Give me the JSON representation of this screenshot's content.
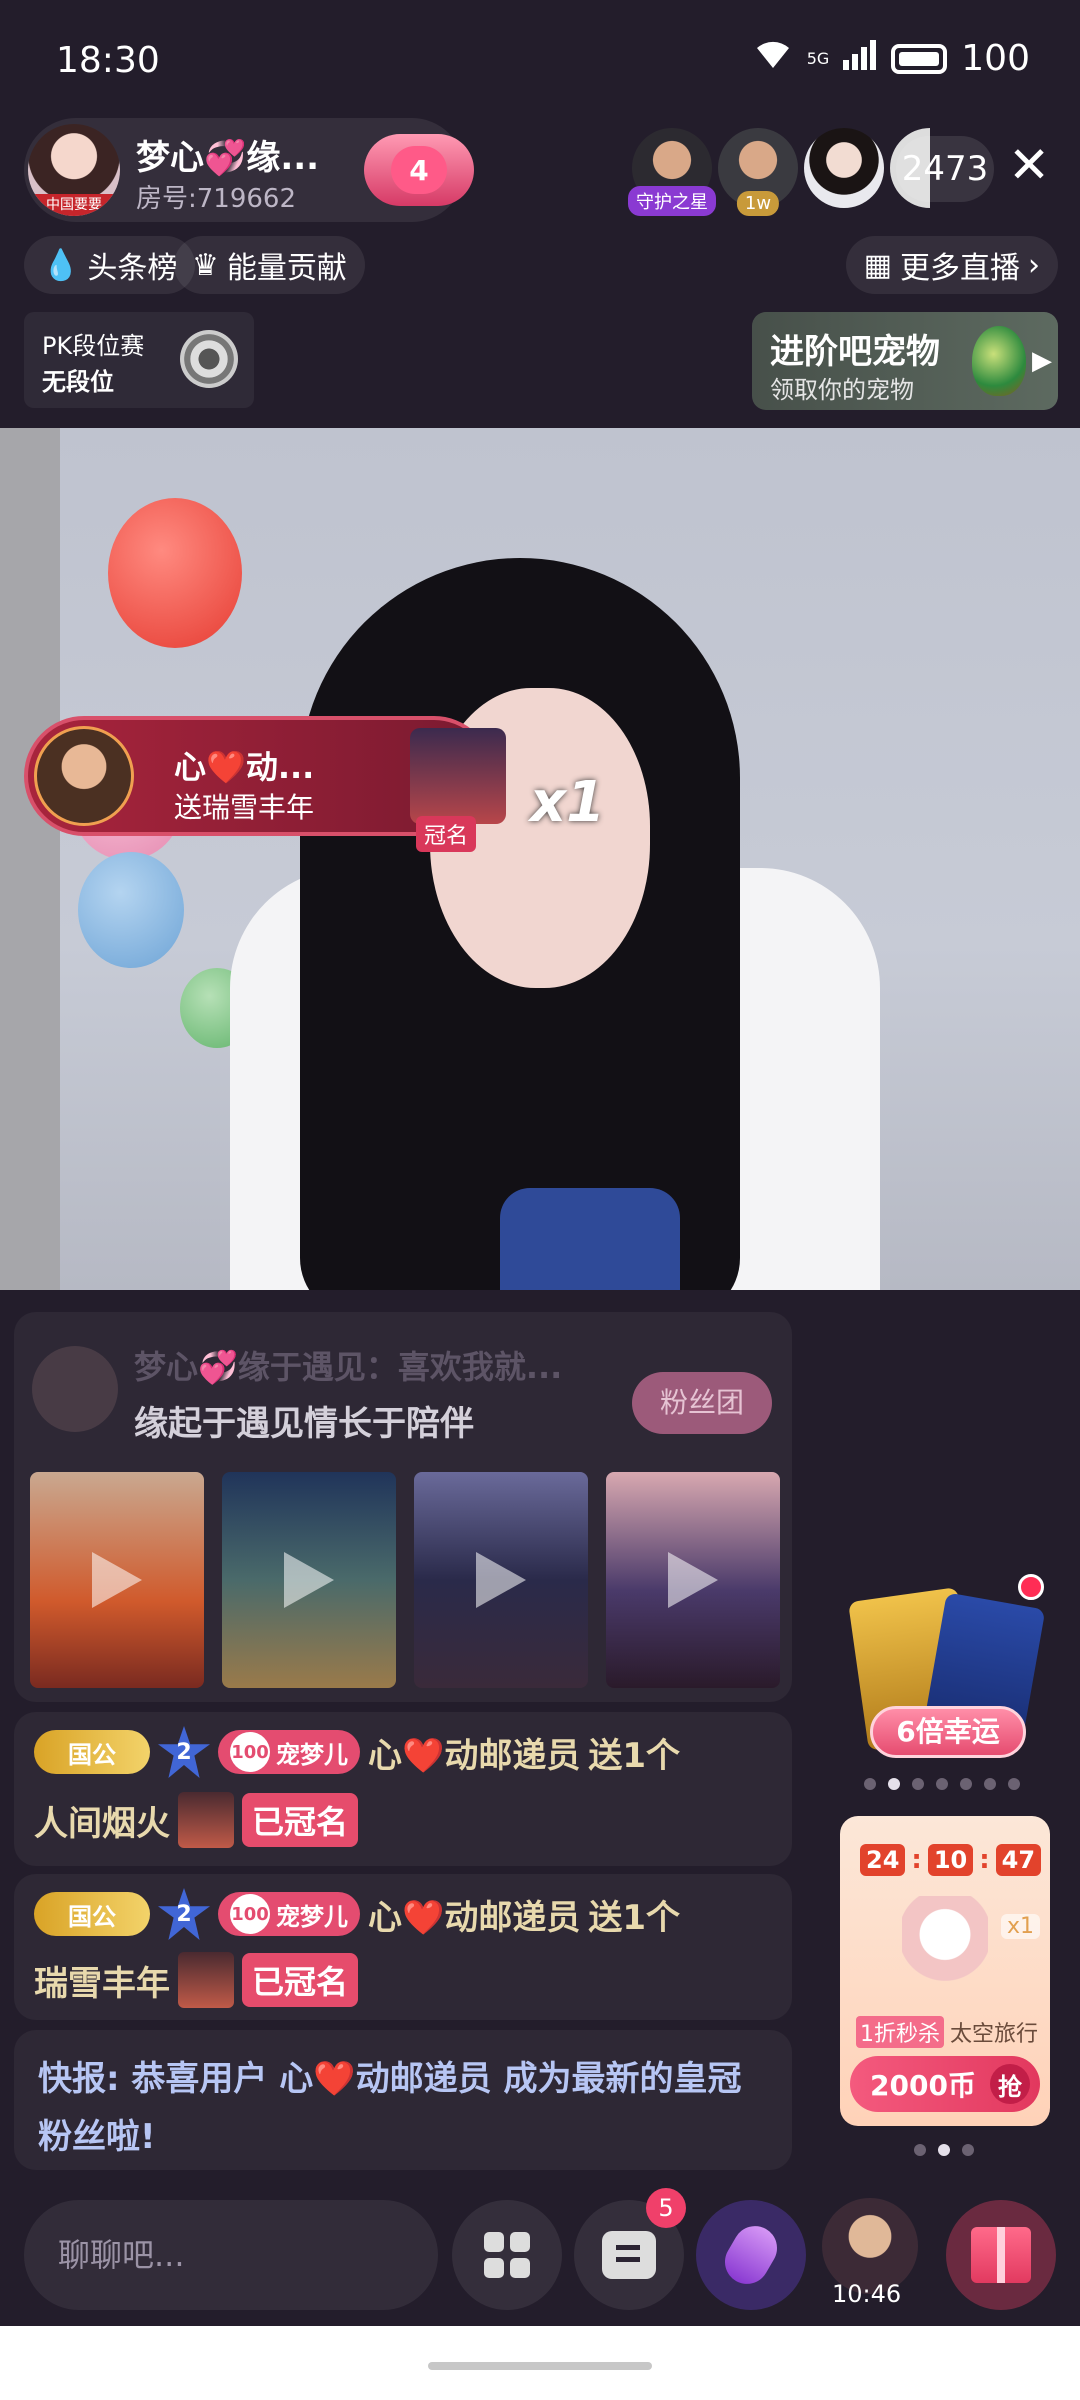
{
  "status_bar": {
    "time": "18:30",
    "network": "5G",
    "battery": "100"
  },
  "host": {
    "name": "梦心💞缘...",
    "room": "房号:719662",
    "level": "4",
    "avatar_badge": "中国要要"
  },
  "viewers": [
    {
      "tag": "守护之星"
    },
    {
      "tag": "1w"
    },
    {
      "tag": ""
    },
    {
      "tag": ""
    }
  ],
  "viewer_count": "2473",
  "chips": {
    "headline": "头条榜",
    "energy": "能量贡献",
    "more": "更多直播"
  },
  "pk": {
    "title": "PK段位赛",
    "rank": "无段位"
  },
  "pet_banner": {
    "title": "进阶吧宠物",
    "subtitle": "领取你的宠物"
  },
  "gift_banner": {
    "sender": "心❤️动...",
    "text": "送瑞雪丰年",
    "tag": "冠名",
    "count": "x1"
  },
  "fan_card": {
    "faded_text": "梦心💞缘于遇见：喜欢我就...",
    "title": "缘起于遇见情长于陪伴",
    "button": "粉丝团"
  },
  "chat": [
    {
      "rank": "国公",
      "star": "2",
      "pet_num": "100",
      "pet_name": "宠梦儿",
      "user": "心❤️动邮递员",
      "action": "送1个",
      "gift": "人间烟火",
      "tag": "已冠名"
    },
    {
      "rank": "国公",
      "star": "2",
      "pet_num": "100",
      "pet_name": "宠梦儿",
      "user": "心❤️动邮递员",
      "action": "送1个",
      "gift": "瑞雪丰年",
      "tag": "已冠名"
    }
  ],
  "news": {
    "prefix": "快报: 恭喜用户 心",
    "heart": "❤️",
    "suffix": "动邮递员 成为最新的皇冠粉丝啦!"
  },
  "lucky": {
    "label": "6倍幸运"
  },
  "flash_sale": {
    "hours": "24",
    "minutes": "10",
    "seconds": "47",
    "qty": "x1",
    "tag": "1折秒杀",
    "name": "太空旅行",
    "price": "2000币",
    "grab": "抢"
  },
  "bottom": {
    "chat_placeholder": "聊聊吧...",
    "msg_badge": "5",
    "clock_time": "10:46"
  }
}
